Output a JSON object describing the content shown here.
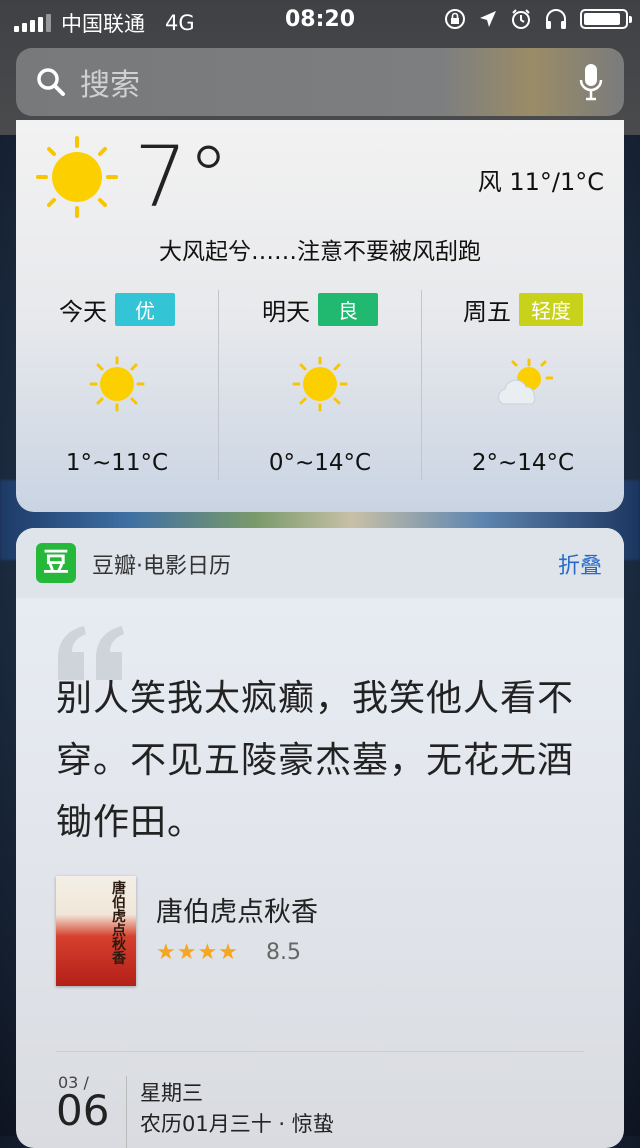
{
  "status_bar": {
    "carrier": "中国联通",
    "network": "4G",
    "time": "08:20"
  },
  "search": {
    "placeholder": "搜索"
  },
  "weather": {
    "current_temp": "7°",
    "wind": "风 11°/1°C",
    "message": "大风起兮……注意不要被风刮跑",
    "forecast": [
      {
        "day": "今天",
        "aqi": "优",
        "aqi_color": "#33c5d6",
        "icon": "sun-icon",
        "range": "1°~11°C"
      },
      {
        "day": "明天",
        "aqi": "良",
        "aqi_color": "#21b870",
        "icon": "sun-icon",
        "range": "0°~14°C"
      },
      {
        "day": "周五",
        "aqi": "轻度",
        "aqi_color": "#c9d21a",
        "icon": "partly-cloudy-icon",
        "range": "2°~14°C"
      }
    ]
  },
  "douban": {
    "logo": "豆",
    "title": "豆瓣·电影日历",
    "fold": "折叠",
    "quote": "别人笑我太疯癫，我笑他人看不穿。不见五陵豪杰墓，无花无酒锄作田。",
    "movie": {
      "title": "唐伯虎点秋香",
      "stars": "★★★★",
      "score": "8.5",
      "poster_text": "唐伯虎点秋香"
    },
    "date": {
      "month": "03 /",
      "day": "06",
      "weekday": "星期三",
      "lunar": "农历01月三十 · 惊蛰"
    }
  }
}
